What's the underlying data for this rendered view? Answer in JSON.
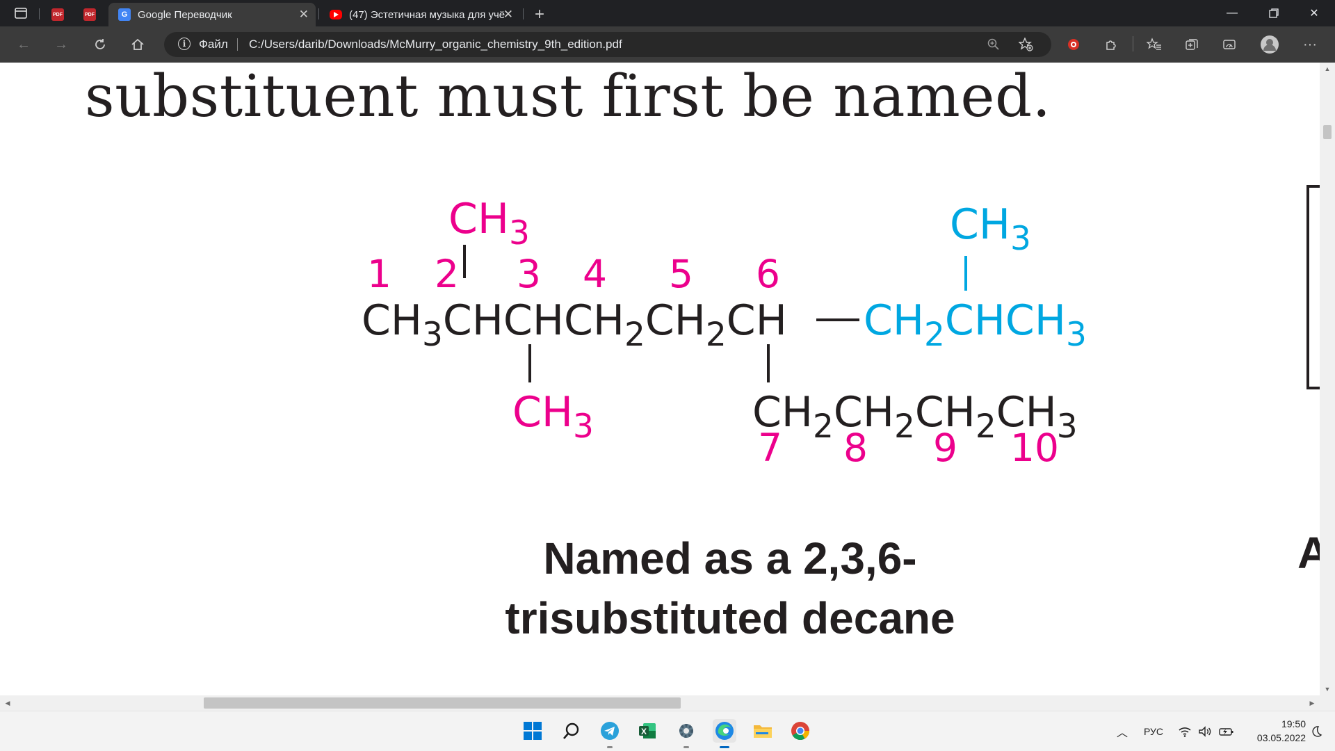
{
  "browser": {
    "tabs": [
      {
        "title": "",
        "favicon": "pdf-icon"
      },
      {
        "title": "",
        "favicon": "pdf-icon"
      },
      {
        "title": "Google Переводчик",
        "favicon": "google-translate-icon"
      },
      {
        "title": "(47) Эстетичная музыка для учё",
        "favicon": "youtube-icon"
      }
    ],
    "new_tab_label": "+",
    "address": {
      "scheme_label": "Файл",
      "url": "C:/Users/darib/Downloads/McMurry_organic_chemistry_9th_edition.pdf"
    }
  },
  "document": {
    "heading": "substituent must first be named.",
    "caption_line1": "Named as a 2,3,6-",
    "caption_line2": "trisubstituted decane",
    "right_edge_text": "A"
  },
  "structure": {
    "colors": {
      "chain": "#231f20",
      "numbers": "#ec008c",
      "substituent": "#00a7e1"
    },
    "numbers": [
      "1",
      "2",
      "3",
      "4",
      "5",
      "6",
      "7",
      "8",
      "9",
      "10"
    ],
    "main_chain": [
      {
        "text": "CH",
        "sub": "3"
      },
      {
        "text": "CHCHCH",
        "sub": "2"
      },
      {
        "text": "CH",
        "sub": "2"
      },
      {
        "text": "CH",
        "sub": ""
      }
    ],
    "dash": "—",
    "branch": [
      {
        "text": "CH",
        "sub": "2"
      },
      {
        "text": "CHCH",
        "sub": "3"
      }
    ],
    "methyl_2": {
      "text": "CH",
      "sub": "3"
    },
    "methyl_3": {
      "text": "CH",
      "sub": "3"
    },
    "branch_methyl": {
      "text": "CH",
      "sub": "3"
    },
    "propyl": [
      {
        "text": "CH",
        "sub": "2"
      },
      {
        "text": "CH",
        "sub": "2"
      },
      {
        "text": "CH",
        "sub": "2"
      },
      {
        "text": "CH",
        "sub": "3"
      }
    ]
  },
  "taskbar": {
    "apps": [
      "windows-start-icon",
      "search-icon",
      "telegram-icon",
      "excel-icon",
      "settings-icon",
      "edge-icon",
      "file-explorer-icon",
      "chrome-icon"
    ],
    "language": "РУС",
    "time": "19:50",
    "date": "03.05.2022"
  }
}
